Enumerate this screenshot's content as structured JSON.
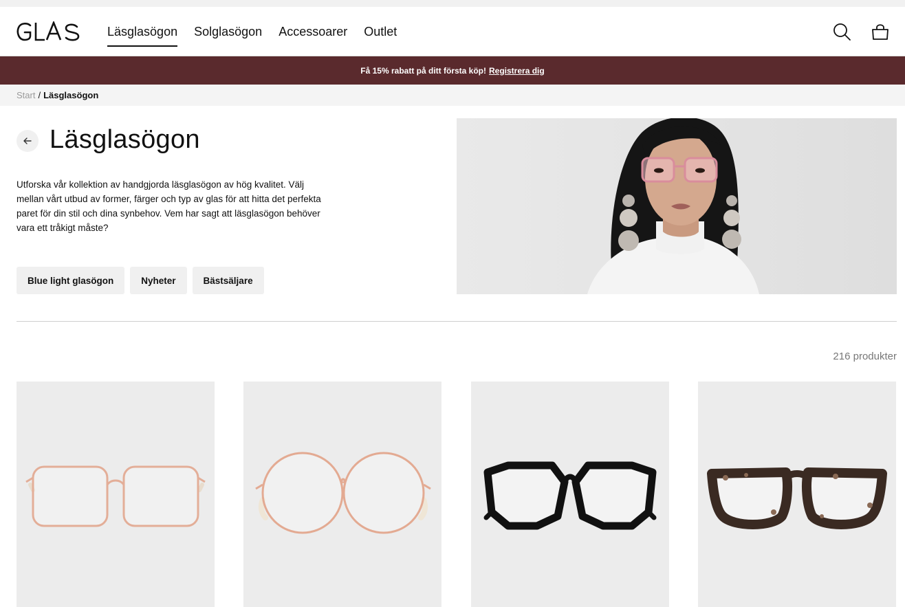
{
  "brand": {
    "logo_text": "GLAS"
  },
  "nav": {
    "items": [
      {
        "label": "Läsglasögon",
        "active": true
      },
      {
        "label": "Solglasögon",
        "active": false
      },
      {
        "label": "Accessoarer",
        "active": false
      },
      {
        "label": "Outlet",
        "active": false
      }
    ],
    "search_icon": "search-icon",
    "cart_icon": "shopping-bag-icon"
  },
  "promo": {
    "text": "Få 15% rabatt på ditt första köp!",
    "link": "Registrera dig",
    "background": "#5a2a2d"
  },
  "breadcrumb": {
    "home": "Start",
    "separator": "/",
    "current": "Läsglasögon"
  },
  "page": {
    "title": "Läsglasögon",
    "description": "Utforska vår kollektion av handgjorda läsglasögon av hög kvalitet. Välj mellan vårt utbud av former, färger och typ av glas för att hitta det perfekta paret för din stil och dina synbehov. Vem har sagt att läsglasögon behöver vara ett tråkigt måste?",
    "back_icon": "arrow-left-icon"
  },
  "filters": [
    {
      "label": "Blue light glasögon"
    },
    {
      "label": "Nyheter"
    },
    {
      "label": "Bästsäljare"
    }
  ],
  "results": {
    "count_label": "216 produkter"
  },
  "products": [
    {
      "style": "square-metal",
      "color": "rose-gold"
    },
    {
      "style": "round-metal",
      "color": "rose-gold"
    },
    {
      "style": "hexagonal-acetate",
      "color": "black"
    },
    {
      "style": "cat-eye-acetate",
      "color": "tortoise"
    }
  ]
}
